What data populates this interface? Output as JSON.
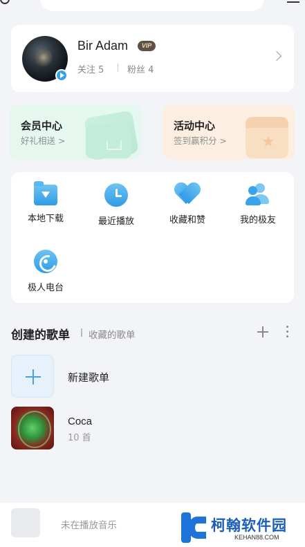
{
  "profile": {
    "username": "Bir Adam",
    "vip_label": "VIP",
    "following": "关注 5",
    "fans": "粉丝 4"
  },
  "promos": {
    "member": {
      "title": "会员中心",
      "subtitle": "好礼相送 >"
    },
    "event": {
      "title": "活动中心",
      "subtitle": "签到赢积分 >"
    }
  },
  "grid": {
    "items": [
      {
        "label": "本地下载",
        "icon": "download-folder-icon"
      },
      {
        "label": "最近播放",
        "icon": "clock-icon"
      },
      {
        "label": "收藏和赞",
        "icon": "heart-icon"
      },
      {
        "label": "我的极友",
        "icon": "friends-icon"
      },
      {
        "label": "极人电台",
        "icon": "radio-disc-icon"
      }
    ]
  },
  "playlists": {
    "tab_created": "创建的歌单",
    "tab_collected": "收藏的歌单",
    "new_label": "新建歌单",
    "items": [
      {
        "title": "Coca",
        "count": "10 首"
      }
    ]
  },
  "player": {
    "status": "未在播放音乐"
  },
  "watermark": {
    "title": "柯翰软件园",
    "url": "KEHAN88.COM"
  },
  "colors": {
    "accent": "#2f9be6",
    "member_bg": "#e6f7f0",
    "event_bg": "#fcefe1",
    "vip_bg": "#5b5148"
  }
}
